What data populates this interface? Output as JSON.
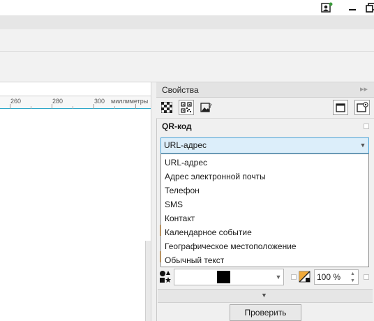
{
  "window": {
    "controls": {
      "account_icon": "user-badge-icon",
      "minimize_icon": "minimize-icon",
      "restore_icon": "restore-icon"
    }
  },
  "ruler": {
    "labels": [
      "260",
      "280",
      "300"
    ],
    "unit": "миллиметры"
  },
  "panel": {
    "title": "Свойства",
    "collapse_glyph": "▸▸",
    "tabs": [
      "checker-pattern-icon",
      "qr-code-icon",
      "image-question-icon"
    ],
    "right_tabs": [
      "frame-icon",
      "frame-eye-icon"
    ],
    "section_title": "QR-код",
    "content_type": {
      "selected": "URL-адрес",
      "options": [
        "URL-адрес",
        "Адрес электронной почты",
        "Телефон",
        "SMS",
        "Контакт",
        "Календарное событие",
        "Географическое местоположение",
        "Обычный текст"
      ]
    },
    "fill": {
      "icon": "shape-fill-icon",
      "color": "#000000",
      "transparency_icon": "transparency-icon",
      "transparency": "100 %"
    },
    "check_button": "Проверить"
  },
  "colors": {
    "accent": "#4aa3d8",
    "combo_bg": "#dceefa",
    "ruler_line": "#2fa7c9"
  }
}
